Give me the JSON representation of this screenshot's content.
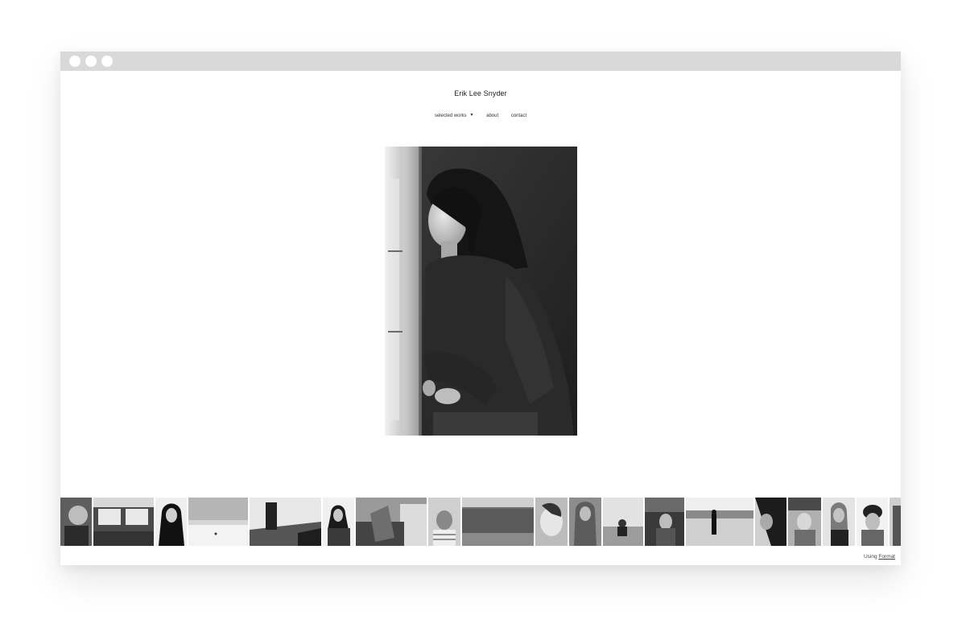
{
  "site": {
    "title": "Erik Lee Snyder"
  },
  "nav": {
    "items": [
      {
        "label": "selected works",
        "has_dropdown": true
      },
      {
        "label": "about"
      },
      {
        "label": "contact"
      }
    ]
  },
  "main_image": {
    "subject": "black and white portrait of a woman with long hair standing by a window"
  },
  "filmstrip": {
    "count": 22
  },
  "footer": {
    "prefix": "Using",
    "link_label": "Format"
  },
  "colors": {
    "titlebar": "#d9d9d9",
    "background": "#ffffff",
    "text": "#222222"
  }
}
